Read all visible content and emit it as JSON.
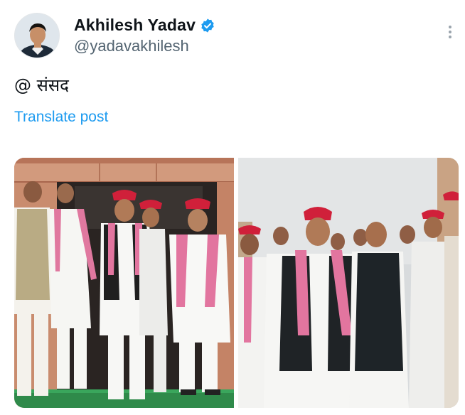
{
  "author": {
    "display_name": "Akhilesh Yadav",
    "handle": "@yadavakhilesh",
    "verified": true,
    "verified_icon": "verified-badge-icon",
    "avatar_icon": "profile-avatar"
  },
  "post": {
    "text": "@ संसद",
    "translate_label": "Translate post"
  },
  "menu": {
    "icon": "more-vertical-icon"
  },
  "colors": {
    "accent": "#1d9bf0",
    "text_primary": "#0f1419",
    "text_secondary": "#536471",
    "red_cap": "#d0203a",
    "pink_stole": "#e2759f"
  },
  "media": {
    "count": 2,
    "items": [
      {
        "description_icon": "group-photo-parliament-entrance"
      },
      {
        "description_icon": "group-photo-parliament-outdoor"
      }
    ]
  }
}
